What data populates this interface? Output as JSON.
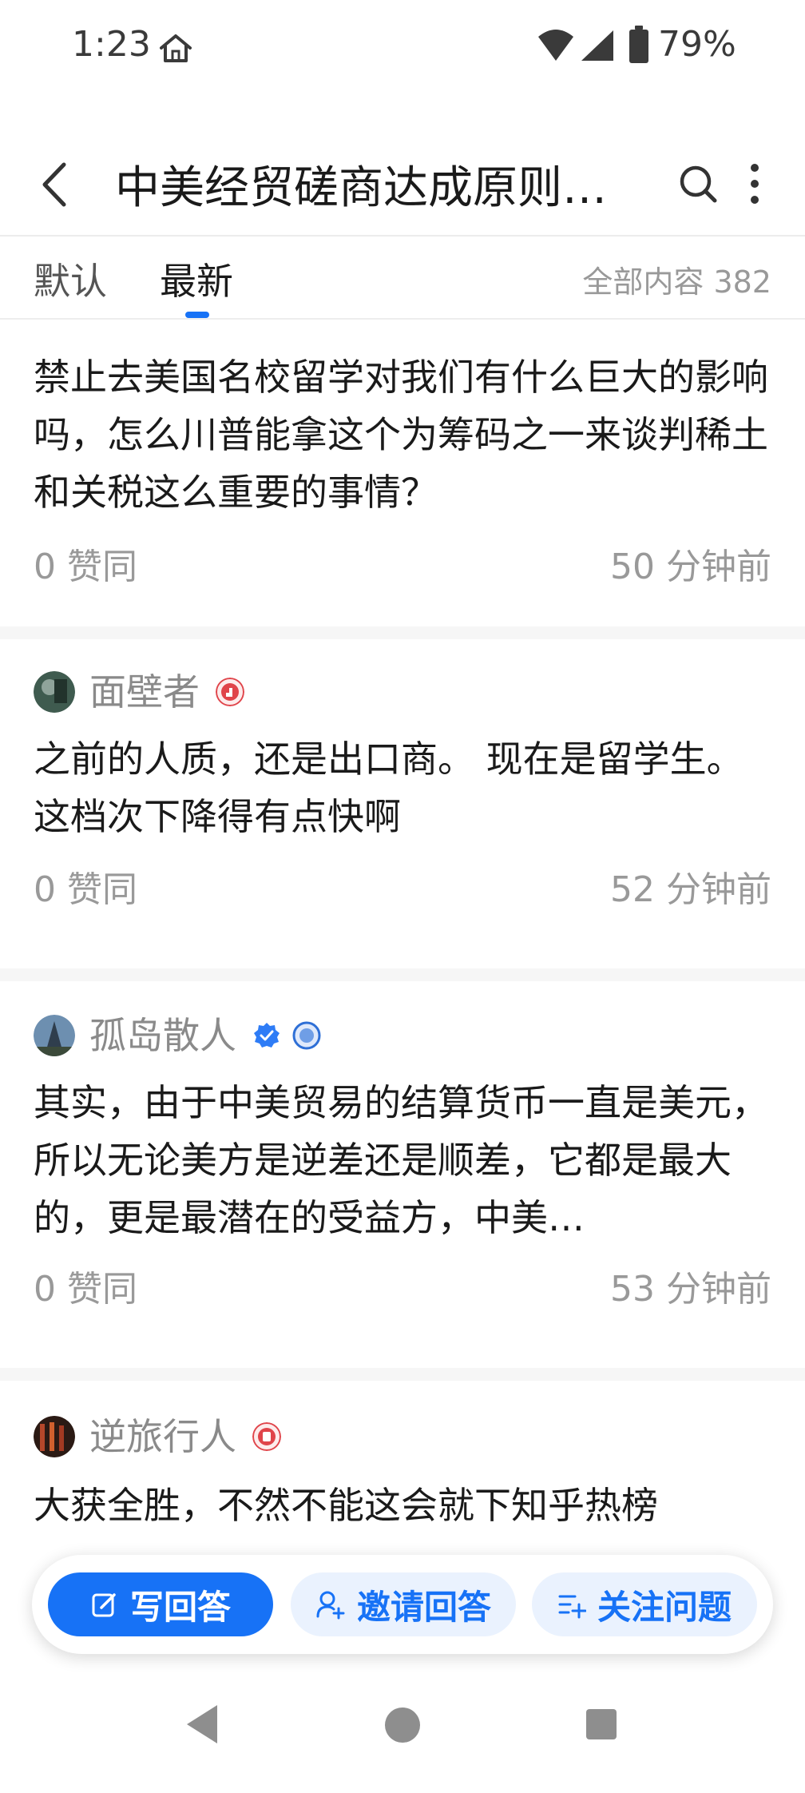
{
  "status_bar": {
    "time": "1:23",
    "battery": "79%",
    "icons": [
      "home-icon",
      "wifi-icon",
      "signal-icon",
      "battery-icon"
    ]
  },
  "header": {
    "title": "中美经贸磋商达成原则共识，美方称中国将提供稀土，美国将允许中国留学生入学，如何看待？",
    "icons": [
      "back-icon",
      "search-icon",
      "more-icon"
    ]
  },
  "tabs": {
    "items": [
      {
        "label": "默认"
      },
      {
        "label": "最新"
      }
    ],
    "selected": "最新",
    "total_label": "全部内容 382"
  },
  "answers": [
    {
      "author": "",
      "text": "禁止去美国名校留学对我们有什么巨大的影响吗，怎么川普能拿这个为筹码之一来谈判稀土和关税这么重要的事情？",
      "likes": "0 赞同",
      "time": "50 分钟前"
    },
    {
      "author": "面壁者",
      "text": "之前的人质，还是出口商。 现在是留学生。 这档次下降得有点快啊",
      "likes": "0 赞同",
      "time": "52 分钟前"
    },
    {
      "author": "孤岛散人",
      "text": "其实，由于中美贸易的结算货币一直是美元，所以无论美方是逆差还是顺差，它都是最大的，更是最潜在的受益方，中美…",
      "likes": "0 赞同",
      "time": "53 分钟前"
    },
    {
      "author": "逆旅行人",
      "text": "大获全胜，不然不能这会就下知乎热榜",
      "likes": "",
      "time": ""
    }
  ],
  "action_bar": {
    "write": "写回答",
    "invite": "邀请回答",
    "follow": "关注问题"
  },
  "nav_bar": {
    "icons": [
      "nav-back-icon",
      "nav-home-icon",
      "nav-recent-icon"
    ]
  },
  "colors": {
    "accent": "#1772f6",
    "accent_light": "#eaf2fe",
    "secondary_text": "#999999",
    "author_text": "#8a8a8a",
    "separator": "#f6f6f6"
  }
}
